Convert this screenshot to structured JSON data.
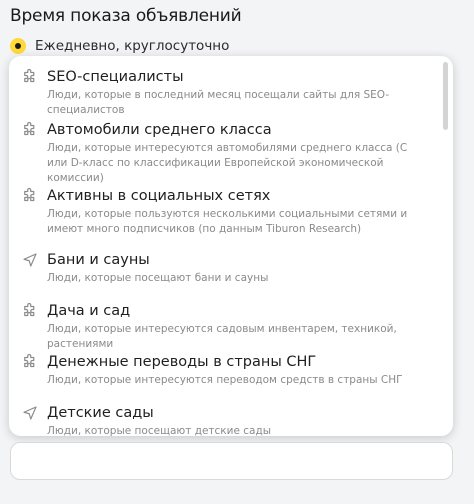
{
  "header": {
    "title": "Время показа объявлений"
  },
  "schedule": {
    "option_label": "Ежедневно, круглосуточно",
    "selected": true
  },
  "dropdown": {
    "items": [
      {
        "title": "SEO-специалисты",
        "desc": "Люди, которые в последний месяц посещали сайты для SEO-специалистов",
        "icon": "puzzle-icon"
      },
      {
        "title": "Автомобили среднего класса",
        "desc": "Люди, которые интересуются автомобилями среднего класса (С или D-класс по классификации Европейской экономической комиссии)",
        "icon": "puzzle-icon"
      },
      {
        "title": "Активны в социальных сетях",
        "desc": "Люди, которые пользуются несколькими социальными сетями и имеют много подписчиков (по данным Tiburon Research)",
        "icon": "puzzle-icon"
      },
      {
        "title": "Бани и сауны",
        "desc": "Люди, которые посещают бани и сауны",
        "icon": "location-arrow-icon"
      },
      {
        "title": "Дача и сад",
        "desc": "Люди, которые интересуются садовым инвентарем, техникой, растениями",
        "icon": "puzzle-icon"
      },
      {
        "title": "Денежные переводы в страны СНГ",
        "desc": "Люди, которые интересуются переводом средств в страны СНГ",
        "icon": "puzzle-icon"
      },
      {
        "title": "Детские сады",
        "desc": "Люди, которые посещают детские сады",
        "icon": "location-arrow-icon"
      }
    ]
  },
  "search": {
    "value": ""
  }
}
